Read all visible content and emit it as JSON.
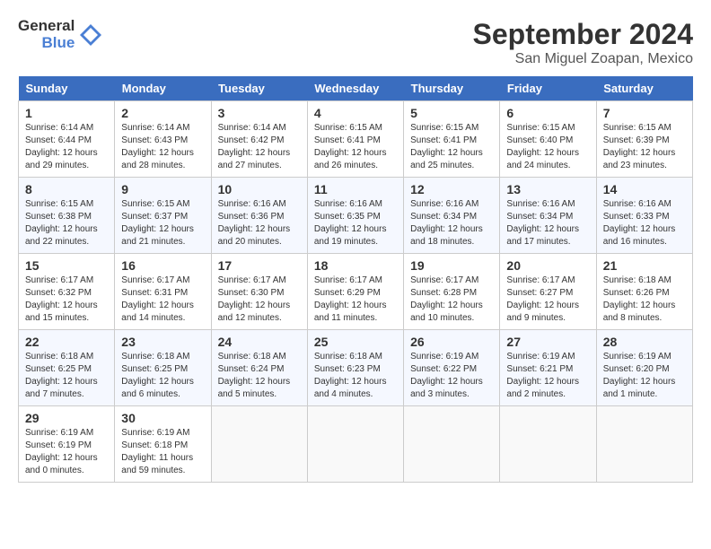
{
  "header": {
    "logo_general": "General",
    "logo_blue": "Blue",
    "month": "September 2024",
    "location": "San Miguel Zoapan, Mexico"
  },
  "weekdays": [
    "Sunday",
    "Monday",
    "Tuesday",
    "Wednesday",
    "Thursday",
    "Friday",
    "Saturday"
  ],
  "weeks": [
    [
      {
        "day": "1",
        "sunrise": "6:14 AM",
        "sunset": "6:44 PM",
        "daylight": "12 hours and 29 minutes."
      },
      {
        "day": "2",
        "sunrise": "6:14 AM",
        "sunset": "6:43 PM",
        "daylight": "12 hours and 28 minutes."
      },
      {
        "day": "3",
        "sunrise": "6:14 AM",
        "sunset": "6:42 PM",
        "daylight": "12 hours and 27 minutes."
      },
      {
        "day": "4",
        "sunrise": "6:15 AM",
        "sunset": "6:41 PM",
        "daylight": "12 hours and 26 minutes."
      },
      {
        "day": "5",
        "sunrise": "6:15 AM",
        "sunset": "6:41 PM",
        "daylight": "12 hours and 25 minutes."
      },
      {
        "day": "6",
        "sunrise": "6:15 AM",
        "sunset": "6:40 PM",
        "daylight": "12 hours and 24 minutes."
      },
      {
        "day": "7",
        "sunrise": "6:15 AM",
        "sunset": "6:39 PM",
        "daylight": "12 hours and 23 minutes."
      }
    ],
    [
      {
        "day": "8",
        "sunrise": "6:15 AM",
        "sunset": "6:38 PM",
        "daylight": "12 hours and 22 minutes."
      },
      {
        "day": "9",
        "sunrise": "6:15 AM",
        "sunset": "6:37 PM",
        "daylight": "12 hours and 21 minutes."
      },
      {
        "day": "10",
        "sunrise": "6:16 AM",
        "sunset": "6:36 PM",
        "daylight": "12 hours and 20 minutes."
      },
      {
        "day": "11",
        "sunrise": "6:16 AM",
        "sunset": "6:35 PM",
        "daylight": "12 hours and 19 minutes."
      },
      {
        "day": "12",
        "sunrise": "6:16 AM",
        "sunset": "6:34 PM",
        "daylight": "12 hours and 18 minutes."
      },
      {
        "day": "13",
        "sunrise": "6:16 AM",
        "sunset": "6:34 PM",
        "daylight": "12 hours and 17 minutes."
      },
      {
        "day": "14",
        "sunrise": "6:16 AM",
        "sunset": "6:33 PM",
        "daylight": "12 hours and 16 minutes."
      }
    ],
    [
      {
        "day": "15",
        "sunrise": "6:17 AM",
        "sunset": "6:32 PM",
        "daylight": "12 hours and 15 minutes."
      },
      {
        "day": "16",
        "sunrise": "6:17 AM",
        "sunset": "6:31 PM",
        "daylight": "12 hours and 14 minutes."
      },
      {
        "day": "17",
        "sunrise": "6:17 AM",
        "sunset": "6:30 PM",
        "daylight": "12 hours and 12 minutes."
      },
      {
        "day": "18",
        "sunrise": "6:17 AM",
        "sunset": "6:29 PM",
        "daylight": "12 hours and 11 minutes."
      },
      {
        "day": "19",
        "sunrise": "6:17 AM",
        "sunset": "6:28 PM",
        "daylight": "12 hours and 10 minutes."
      },
      {
        "day": "20",
        "sunrise": "6:17 AM",
        "sunset": "6:27 PM",
        "daylight": "12 hours and 9 minutes."
      },
      {
        "day": "21",
        "sunrise": "6:18 AM",
        "sunset": "6:26 PM",
        "daylight": "12 hours and 8 minutes."
      }
    ],
    [
      {
        "day": "22",
        "sunrise": "6:18 AM",
        "sunset": "6:25 PM",
        "daylight": "12 hours and 7 minutes."
      },
      {
        "day": "23",
        "sunrise": "6:18 AM",
        "sunset": "6:25 PM",
        "daylight": "12 hours and 6 minutes."
      },
      {
        "day": "24",
        "sunrise": "6:18 AM",
        "sunset": "6:24 PM",
        "daylight": "12 hours and 5 minutes."
      },
      {
        "day": "25",
        "sunrise": "6:18 AM",
        "sunset": "6:23 PM",
        "daylight": "12 hours and 4 minutes."
      },
      {
        "day": "26",
        "sunrise": "6:19 AM",
        "sunset": "6:22 PM",
        "daylight": "12 hours and 3 minutes."
      },
      {
        "day": "27",
        "sunrise": "6:19 AM",
        "sunset": "6:21 PM",
        "daylight": "12 hours and 2 minutes."
      },
      {
        "day": "28",
        "sunrise": "6:19 AM",
        "sunset": "6:20 PM",
        "daylight": "12 hours and 1 minute."
      }
    ],
    [
      {
        "day": "29",
        "sunrise": "6:19 AM",
        "sunset": "6:19 PM",
        "daylight": "12 hours and 0 minutes."
      },
      {
        "day": "30",
        "sunrise": "6:19 AM",
        "sunset": "6:18 PM",
        "daylight": "11 hours and 59 minutes."
      },
      null,
      null,
      null,
      null,
      null
    ]
  ]
}
